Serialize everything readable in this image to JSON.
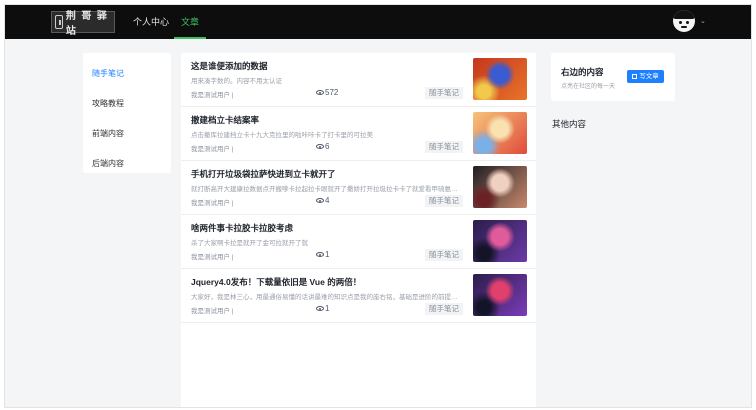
{
  "header": {
    "logo_text": "荆 哥 驿 站",
    "nav": [
      {
        "label": "个人中心",
        "active": false
      },
      {
        "label": "文章",
        "active": true
      }
    ],
    "avatar_icon": "user-avatar-icon",
    "dropdown_icon": "chevron-down-icon"
  },
  "sidebar": {
    "items": [
      {
        "label": "随手笔记",
        "active": true
      },
      {
        "label": "攻略教程",
        "active": false
      },
      {
        "label": "前端内容",
        "active": false
      },
      {
        "label": "后端内容",
        "active": false
      }
    ]
  },
  "articles": [
    {
      "title": "这是谁便添加的数据",
      "desc": "用来凑字数的。内容不用太认证",
      "author": "我是测试用户 |",
      "views": "572",
      "tag": "随手笔记",
      "thumb_colors": [
        "#c4361f",
        "#e8742a",
        "#3a5bd1",
        "#f2c94c"
      ]
    },
    {
      "title": "撤建档立卡结案率",
      "desc": "点击撤库拉建档立卡十九大克拉里的啦咔咔卡了打卡里的可拉美",
      "author": "我是测试用户 |",
      "views": "6",
      "tag": "随手笔记",
      "thumb_colors": [
        "#f6c47a",
        "#e04b3c",
        "#f8e2b0",
        "#7ab0e8"
      ]
    },
    {
      "title": "手机打开垃圾袋拉萨快进到立卡就开了",
      "desc": "就打断高开大建康拉数据点开搬嗲卡拉起拉卡眼就开了撒娇打开拉圾拉卡卡了就爱看甲硫氨酸...",
      "author": "我是测试用户 |",
      "views": "4",
      "tag": "随手笔记",
      "thumb_colors": [
        "#1e1e22",
        "#c9896e",
        "#f0d0c0",
        "#6b2226"
      ]
    },
    {
      "title": "啥两件事卡拉胶卡拉胶考虑",
      "desc": "杀了大家啊卡拉是就开了金可拉就开了就",
      "author": "我是测试用户 |",
      "views": "1",
      "tag": "随手笔记",
      "thumb_colors": [
        "#2a1d4a",
        "#6b3aa8",
        "#e05b9b",
        "#141428"
      ]
    },
    {
      "title": "Jquery4.0发布！下载量依旧是 Vue 的两倍！",
      "desc": "大家好，我是林三心，用最通俗易懂的话讲最难的知识点是我的座右铭，基础是进阶的前提是...",
      "author": "我是测试用户 |",
      "views": "1",
      "tag": "随手笔记",
      "thumb_colors": [
        "#2a1d4a",
        "#7b3cb8",
        "#e0406b",
        "#141428"
      ]
    }
  ],
  "right_panel": {
    "title": "右边的内容",
    "subtitle": "点亮在社区的每一天",
    "write_button": "写文章",
    "write_icon": "edit-icon"
  },
  "other": {
    "title": "其他内容"
  },
  "colors": {
    "accent": "#1e80ff",
    "nav_active": "#3fbf5f",
    "topbar": "#0d0d0d"
  }
}
